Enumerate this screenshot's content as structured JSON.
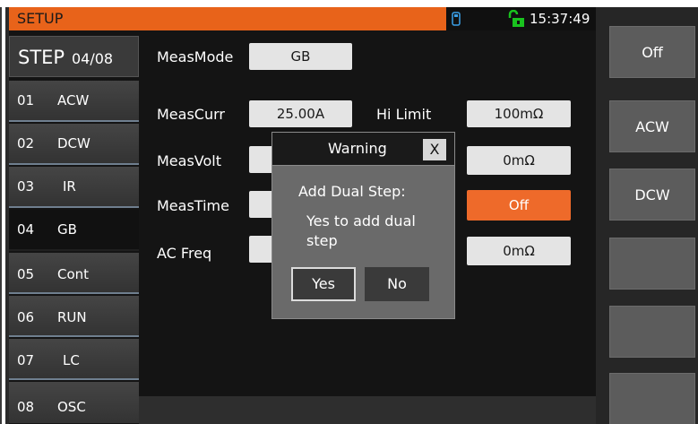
{
  "header": {
    "title": "SETUP",
    "time": "15:37:49"
  },
  "step": {
    "label": "STEP",
    "counter": "04/08"
  },
  "steps": [
    {
      "num": "01",
      "name": "ACW"
    },
    {
      "num": "02",
      "name": "DCW"
    },
    {
      "num": "03",
      "name": "IR"
    },
    {
      "num": "04",
      "name": "GB"
    },
    {
      "num": "05",
      "name": "Cont"
    },
    {
      "num": "06",
      "name": "RUN"
    },
    {
      "num": "07",
      "name": "LC"
    },
    {
      "num": "08",
      "name": "OSC"
    }
  ],
  "params": {
    "meas_mode_label": "MeasMode",
    "meas_mode_value": "GB",
    "meas_curr_label": "MeasCurr",
    "meas_curr_value": "25.00A",
    "meas_volt_label": "MeasVolt",
    "meas_time_label": "MeasTime",
    "ac_freq_label": "AC Freq",
    "hi_limit_label": "Hi Limit",
    "hi_limit_value": "100mΩ",
    "right_value_2": "0mΩ",
    "right_value_3": "Off",
    "right_value_4": "0mΩ"
  },
  "softkeys": [
    "Off",
    "ACW",
    "DCW"
  ],
  "dialog": {
    "title": "Warning",
    "close": "X",
    "line1": "Add Dual Step:",
    "line2": "Yes to add dual step",
    "yes": "Yes",
    "no": "No"
  },
  "colors": {
    "header_accent": "#e8631a",
    "selected_value": "#ee6a2a"
  },
  "icons": [
    "usb-icon",
    "unlock-icon"
  ]
}
